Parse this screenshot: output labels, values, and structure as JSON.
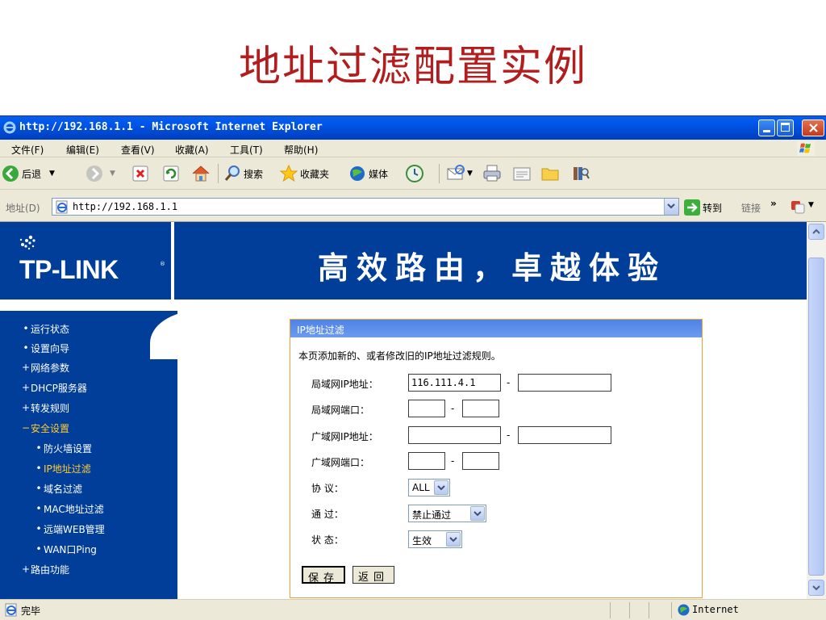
{
  "slide": {
    "title": "地址过滤配置实例"
  },
  "window": {
    "title": "http://192.168.1.1 - Microsoft Internet Explorer",
    "menu": [
      "文件(F)",
      "编辑(E)",
      "查看(V)",
      "收藏(A)",
      "工具(T)",
      "帮助(H)"
    ],
    "toolbar": {
      "back_label": "后退",
      "search_label": "搜索",
      "favorites_label": "收藏夹",
      "media_label": "媒体"
    },
    "address": {
      "label": "地址(D)",
      "url": "http://192.168.1.1",
      "go_label": "转到",
      "links_label": "链接",
      "links_chevron": "»"
    },
    "status": {
      "text": "完毕",
      "zone": "Internet"
    }
  },
  "page": {
    "logo_text": "TP-LINK",
    "logo_reg": "®",
    "slogan": "高效路由，卓越体验",
    "nav": [
      {
        "label": "运行状态",
        "bullet": "•"
      },
      {
        "label": "设置向导",
        "bullet": "•"
      },
      {
        "label": "网络参数",
        "bullet": "+"
      },
      {
        "label": "DHCP服务器",
        "bullet": "+"
      },
      {
        "label": "转发规则",
        "bullet": "+"
      },
      {
        "label": "安全设置",
        "bullet": "−"
      },
      {
        "label": "防火墙设置",
        "bullet": "•"
      },
      {
        "label": "IP地址过滤",
        "bullet": "•"
      },
      {
        "label": "域名过滤",
        "bullet": "•"
      },
      {
        "label": "MAC地址过滤",
        "bullet": "•"
      },
      {
        "label": "远端WEB管理",
        "bullet": "•"
      },
      {
        "label": "WAN口Ping",
        "bullet": "•"
      },
      {
        "label": "路由功能",
        "bullet": "+"
      }
    ],
    "panel": {
      "header": "IP地址过滤",
      "description": "本页添加新的、或者修改旧的IP地址过滤规则。",
      "lan_ip_label": "局域网IP地址：",
      "lan_ip_start": "116.111.4.1",
      "lan_ip_end": "",
      "lan_port_label": "局域网端口：",
      "lan_port_start": "",
      "lan_port_end": "",
      "wan_ip_label": "广域网IP地址：",
      "wan_ip_start": "",
      "wan_ip_end": "",
      "wan_port_label": "广域网端口：",
      "wan_port_start": "",
      "wan_port_end": "",
      "protocol_label": "协 议：",
      "protocol_value": "ALL",
      "pass_label": "通 过：",
      "pass_value": "禁止通过",
      "state_label": "状 态：",
      "state_value": "生效",
      "dash": "-",
      "save_label": "保存",
      "back_label": "返回"
    }
  },
  "colors": {
    "slide_title": "#b21e1e",
    "banner": "#003e9a",
    "nav_active": "#ffcc33",
    "panel_border": "#f0a030",
    "panel_header": "#5a8ce8"
  }
}
